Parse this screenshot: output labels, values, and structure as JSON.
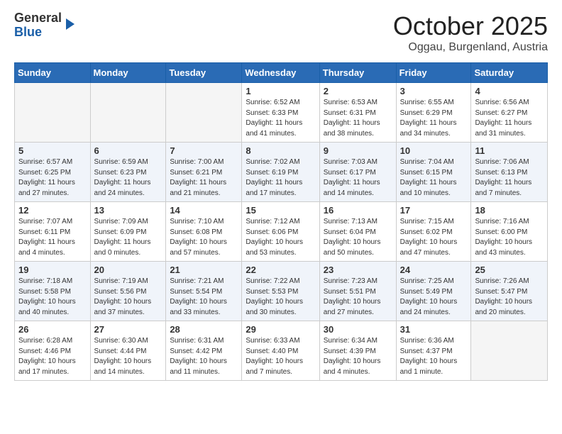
{
  "header": {
    "logo_general": "General",
    "logo_blue": "Blue",
    "month_title": "October 2025",
    "location": "Oggau, Burgenland, Austria"
  },
  "days_of_week": [
    "Sunday",
    "Monday",
    "Tuesday",
    "Wednesday",
    "Thursday",
    "Friday",
    "Saturday"
  ],
  "weeks": [
    [
      {
        "day": "",
        "info": ""
      },
      {
        "day": "",
        "info": ""
      },
      {
        "day": "",
        "info": ""
      },
      {
        "day": "1",
        "info": "Sunrise: 6:52 AM\nSunset: 6:33 PM\nDaylight: 11 hours and 41 minutes."
      },
      {
        "day": "2",
        "info": "Sunrise: 6:53 AM\nSunset: 6:31 PM\nDaylight: 11 hours and 38 minutes."
      },
      {
        "day": "3",
        "info": "Sunrise: 6:55 AM\nSunset: 6:29 PM\nDaylight: 11 hours and 34 minutes."
      },
      {
        "day": "4",
        "info": "Sunrise: 6:56 AM\nSunset: 6:27 PM\nDaylight: 11 hours and 31 minutes."
      }
    ],
    [
      {
        "day": "5",
        "info": "Sunrise: 6:57 AM\nSunset: 6:25 PM\nDaylight: 11 hours and 27 minutes."
      },
      {
        "day": "6",
        "info": "Sunrise: 6:59 AM\nSunset: 6:23 PM\nDaylight: 11 hours and 24 minutes."
      },
      {
        "day": "7",
        "info": "Sunrise: 7:00 AM\nSunset: 6:21 PM\nDaylight: 11 hours and 21 minutes."
      },
      {
        "day": "8",
        "info": "Sunrise: 7:02 AM\nSunset: 6:19 PM\nDaylight: 11 hours and 17 minutes."
      },
      {
        "day": "9",
        "info": "Sunrise: 7:03 AM\nSunset: 6:17 PM\nDaylight: 11 hours and 14 minutes."
      },
      {
        "day": "10",
        "info": "Sunrise: 7:04 AM\nSunset: 6:15 PM\nDaylight: 11 hours and 10 minutes."
      },
      {
        "day": "11",
        "info": "Sunrise: 7:06 AM\nSunset: 6:13 PM\nDaylight: 11 hours and 7 minutes."
      }
    ],
    [
      {
        "day": "12",
        "info": "Sunrise: 7:07 AM\nSunset: 6:11 PM\nDaylight: 11 hours and 4 minutes."
      },
      {
        "day": "13",
        "info": "Sunrise: 7:09 AM\nSunset: 6:09 PM\nDaylight: 11 hours and 0 minutes."
      },
      {
        "day": "14",
        "info": "Sunrise: 7:10 AM\nSunset: 6:08 PM\nDaylight: 10 hours and 57 minutes."
      },
      {
        "day": "15",
        "info": "Sunrise: 7:12 AM\nSunset: 6:06 PM\nDaylight: 10 hours and 53 minutes."
      },
      {
        "day": "16",
        "info": "Sunrise: 7:13 AM\nSunset: 6:04 PM\nDaylight: 10 hours and 50 minutes."
      },
      {
        "day": "17",
        "info": "Sunrise: 7:15 AM\nSunset: 6:02 PM\nDaylight: 10 hours and 47 minutes."
      },
      {
        "day": "18",
        "info": "Sunrise: 7:16 AM\nSunset: 6:00 PM\nDaylight: 10 hours and 43 minutes."
      }
    ],
    [
      {
        "day": "19",
        "info": "Sunrise: 7:18 AM\nSunset: 5:58 PM\nDaylight: 10 hours and 40 minutes."
      },
      {
        "day": "20",
        "info": "Sunrise: 7:19 AM\nSunset: 5:56 PM\nDaylight: 10 hours and 37 minutes."
      },
      {
        "day": "21",
        "info": "Sunrise: 7:21 AM\nSunset: 5:54 PM\nDaylight: 10 hours and 33 minutes."
      },
      {
        "day": "22",
        "info": "Sunrise: 7:22 AM\nSunset: 5:53 PM\nDaylight: 10 hours and 30 minutes."
      },
      {
        "day": "23",
        "info": "Sunrise: 7:23 AM\nSunset: 5:51 PM\nDaylight: 10 hours and 27 minutes."
      },
      {
        "day": "24",
        "info": "Sunrise: 7:25 AM\nSunset: 5:49 PM\nDaylight: 10 hours and 24 minutes."
      },
      {
        "day": "25",
        "info": "Sunrise: 7:26 AM\nSunset: 5:47 PM\nDaylight: 10 hours and 20 minutes."
      }
    ],
    [
      {
        "day": "26",
        "info": "Sunrise: 6:28 AM\nSunset: 4:46 PM\nDaylight: 10 hours and 17 minutes."
      },
      {
        "day": "27",
        "info": "Sunrise: 6:30 AM\nSunset: 4:44 PM\nDaylight: 10 hours and 14 minutes."
      },
      {
        "day": "28",
        "info": "Sunrise: 6:31 AM\nSunset: 4:42 PM\nDaylight: 10 hours and 11 minutes."
      },
      {
        "day": "29",
        "info": "Sunrise: 6:33 AM\nSunset: 4:40 PM\nDaylight: 10 hours and 7 minutes."
      },
      {
        "day": "30",
        "info": "Sunrise: 6:34 AM\nSunset: 4:39 PM\nDaylight: 10 hours and 4 minutes."
      },
      {
        "day": "31",
        "info": "Sunrise: 6:36 AM\nSunset: 4:37 PM\nDaylight: 10 hours and 1 minute."
      },
      {
        "day": "",
        "info": ""
      }
    ]
  ]
}
